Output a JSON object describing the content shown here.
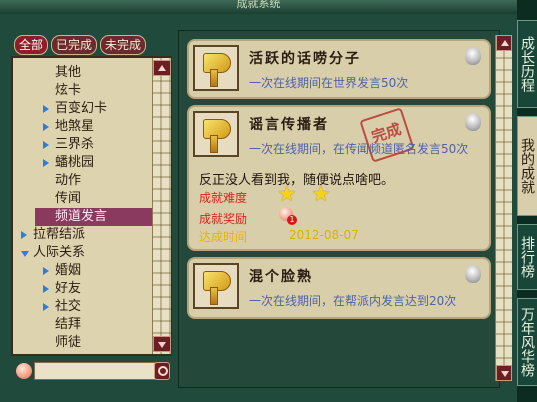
{
  "window": {
    "title": "成就系统"
  },
  "filters": {
    "all": "全部",
    "done": "已完成",
    "undone": "未完成"
  },
  "tree": [
    {
      "label": "其他",
      "level": 2,
      "expand": ""
    },
    {
      "label": "炫卡",
      "level": 2,
      "expand": ""
    },
    {
      "label": "百变幻卡",
      "level": 2,
      "expand": "right"
    },
    {
      "label": "地煞星",
      "level": 2,
      "expand": "right"
    },
    {
      "label": "三界杀",
      "level": 2,
      "expand": "right"
    },
    {
      "label": "蟠桃园",
      "level": 2,
      "expand": "right"
    },
    {
      "label": "动作",
      "level": 2,
      "expand": ""
    },
    {
      "label": "传闻",
      "level": 2,
      "expand": ""
    },
    {
      "label": "频道发言",
      "level": 2,
      "expand": "",
      "selected": true
    },
    {
      "label": "拉帮结派",
      "level": 1,
      "expand": "right"
    },
    {
      "label": "人际关系",
      "level": 1,
      "expand": "down"
    },
    {
      "label": "婚姻",
      "level": 2,
      "expand": "right"
    },
    {
      "label": "好友",
      "level": 2,
      "expand": "right"
    },
    {
      "label": "社交",
      "level": 2,
      "expand": "right"
    },
    {
      "label": "结拜",
      "level": 2,
      "expand": ""
    },
    {
      "label": "师徒",
      "level": 2,
      "expand": ""
    }
  ],
  "search": {
    "value": ""
  },
  "cards": [
    {
      "title": "活跃的话唠分子",
      "desc": "一次在线期间在世界发言50次"
    },
    {
      "title": "谣言传播者",
      "desc": "一次在线期间，在传闻频道匿名发言50次",
      "stamp": "完成",
      "quote": "反正没人看到我，随便说点啥吧。",
      "difficulty_label": "成就难度",
      "difficulty_stars": 2,
      "reward_label": "成就奖励",
      "reward_count": "1",
      "time_label": "达成时间",
      "time_value": "2012-08-07"
    },
    {
      "title": "混个脸熟",
      "desc": "一次在线期间，在帮派内发言达到20次"
    }
  ],
  "side_tabs": [
    {
      "label": "成长历程",
      "active": false
    },
    {
      "label": "我的成就",
      "active": true
    },
    {
      "label": "排行榜",
      "active": false
    },
    {
      "label": "万年风华榜",
      "active": false
    }
  ],
  "colors": {
    "accent": "#8e1d27",
    "panel": "#d9ceaa",
    "selected": "#8a3a5e"
  }
}
